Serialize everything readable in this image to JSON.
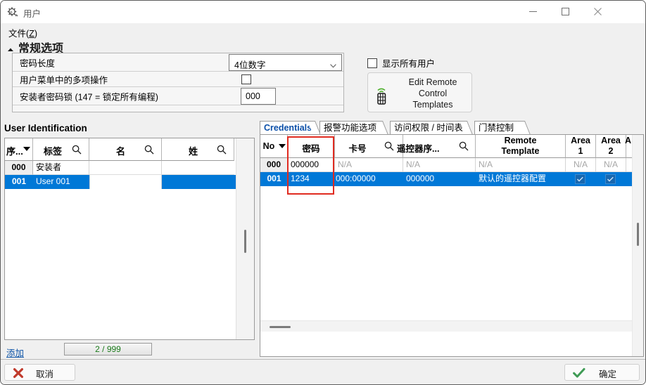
{
  "window": {
    "title": "用户",
    "icon": "gear-user-icon",
    "controls": {
      "minimize": "—",
      "maximize": "□",
      "close": "✕"
    }
  },
  "menubar": {
    "file": "文件(Z)",
    "file_text": "文件",
    "file_mnemonic": "Z"
  },
  "general_options": {
    "title": "常规选项",
    "collapse_icon": "chevron-up-icon",
    "rows": [
      {
        "label": "密码长度",
        "control": "select",
        "value": "4位数字"
      },
      {
        "label": "用户菜单中的多项操作",
        "control": "checkbox",
        "checked": false
      },
      {
        "label": "安装者密码锁 (147 = 锁定所有编程)",
        "control": "textbox",
        "value": "000"
      }
    ]
  },
  "show_all_users": {
    "label": "显示所有用户",
    "checked": false
  },
  "remote_button": {
    "label": "Edit Remote\nControl\nTemplates",
    "line1": "Edit Remote",
    "line2": "Control",
    "line3": "Templates",
    "icon": "remote-control-icon"
  },
  "user_identification": {
    "heading": "User Identification",
    "columns": [
      {
        "label": "序...",
        "sort": "desc",
        "search": false
      },
      {
        "label": "标签",
        "search": true
      },
      {
        "label": "名",
        "search": true
      },
      {
        "label": "姓",
        "search": true
      }
    ],
    "rows": [
      {
        "no": "000",
        "label": "安装者",
        "first": "",
        "last": "",
        "selected": false
      },
      {
        "no": "001",
        "label": "User 001",
        "first": "",
        "last": "",
        "selected": true
      }
    ],
    "add_link": "添加",
    "counter": "2 / 999"
  },
  "tabs": [
    {
      "label": "Credentials",
      "active": true
    },
    {
      "label": "报警功能选项",
      "active": false
    },
    {
      "label": "访问权限 / 时间表",
      "active": false
    },
    {
      "label": "门禁控制",
      "active": false
    }
  ],
  "credentials": {
    "columns": [
      {
        "label": "No",
        "sort": "desc",
        "search": false
      },
      {
        "label": "密码",
        "search": false,
        "highlighted": true
      },
      {
        "label": "卡号",
        "search": true
      },
      {
        "label": "遥控器序...",
        "search": true
      },
      {
        "label": "Remote\nTemplate",
        "line1": "Remote",
        "line2": "Template",
        "search": false
      },
      {
        "label": "Area\n1",
        "line1": "Area",
        "line2": "1"
      },
      {
        "label": "Area\n2",
        "line1": "Area",
        "line2": "2"
      },
      {
        "label": "A",
        "partial": true
      }
    ],
    "rows": [
      {
        "no": "000",
        "password": "000000",
        "card": "N/A",
        "remote_serial": "N/A",
        "remote_template": "N/A",
        "area1": "N/A",
        "area2": "N/A",
        "selected": false
      },
      {
        "no": "001",
        "password": "1234",
        "card": "000:00000",
        "remote_serial": "000000",
        "remote_template": "默认的遥控器配置",
        "area1": "checked",
        "area2": "checked",
        "selected": true
      }
    ]
  },
  "footer": {
    "cancel": "取消",
    "cancel_icon": "red-x-icon",
    "ok": "确定",
    "ok_icon": "green-check-icon"
  },
  "colors": {
    "selection_blue": "#0078d7",
    "tab_active_blue": "#0b4fa8",
    "link_blue": "#0b52a6",
    "counter_green": "#1a7a1a",
    "highlight_red": "#e02b20",
    "window_bg": "#f0f0f0"
  }
}
